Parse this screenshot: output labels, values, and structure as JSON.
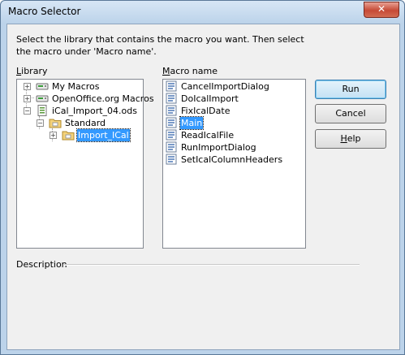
{
  "window": {
    "title": "Macro Selector",
    "close_glyph": "✕"
  },
  "instruction": "Select the library that contains the macro you want. Then select the macro under 'Macro name'.",
  "library": {
    "label_mnemonic": "L",
    "label_rest": "ibrary",
    "items": [
      {
        "label": "My Macros",
        "expander": "+",
        "icon": "macro-container-icon"
      },
      {
        "label": "OpenOffice.org Macros",
        "expander": "+",
        "icon": "macro-container-icon"
      },
      {
        "label": "iCal_Import_04.ods",
        "expander": "−",
        "icon": "spreadsheet-document-icon"
      },
      {
        "label": "Standard",
        "expander": "−",
        "icon": "library-folder-icon"
      },
      {
        "label": "Import_ICal",
        "expander": "+",
        "icon": "module-folder-icon",
        "selected": true
      }
    ]
  },
  "macros": {
    "label_mnemonic": "M",
    "label_rest": "acro name",
    "items": [
      {
        "label": "CancelImportDialog"
      },
      {
        "label": "DoIcalImport"
      },
      {
        "label": "FixIcalDate"
      },
      {
        "label": "Main",
        "selected": true
      },
      {
        "label": "ReadIcalFile"
      },
      {
        "label": "RunImportDialog"
      },
      {
        "label": "SetIcalColumnHeaders"
      }
    ]
  },
  "buttons": {
    "run": "Run",
    "cancel": "Cancel",
    "help_mnemonic": "H",
    "help_rest": "elp"
  },
  "description": {
    "label": "Description"
  },
  "colors": {
    "selection": "#3399ff",
    "title_bg": "#bcd3ea",
    "close": "#c64a36"
  }
}
